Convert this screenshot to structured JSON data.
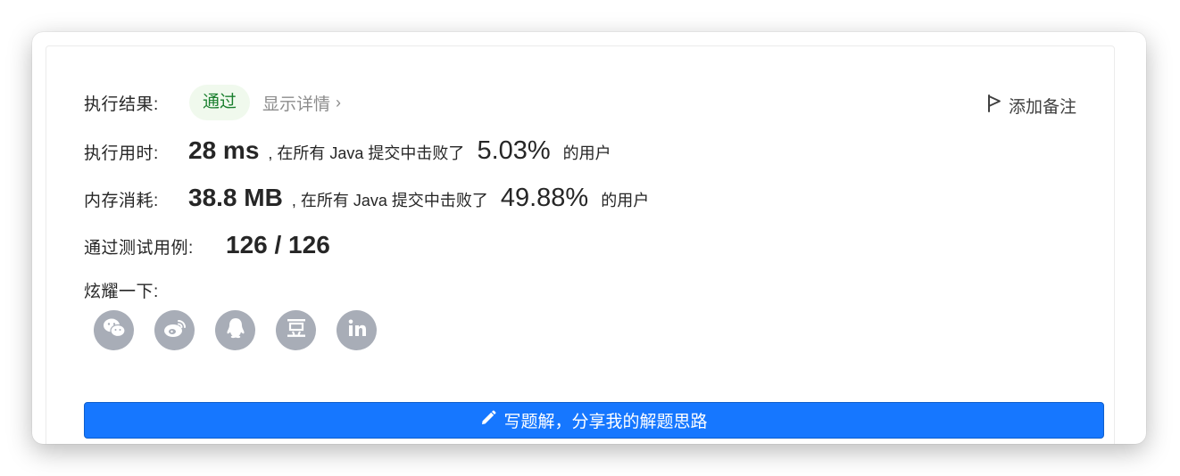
{
  "result": {
    "label": "执行结果:",
    "status": "通过",
    "details_link": "显示详情",
    "details_chevron": "›",
    "add_note": "添加备注"
  },
  "runtime": {
    "label": "执行用时:",
    "value": "28 ms",
    "text_before": ", 在所有 Java 提交中击败了",
    "percent": "5.03%",
    "text_after": "的用户"
  },
  "memory": {
    "label": "内存消耗:",
    "value": "38.8 MB",
    "text_before": ", 在所有 Java 提交中击败了",
    "percent": "49.88%",
    "text_after": "的用户"
  },
  "testcases": {
    "label": "通过测试用例:",
    "value": "126 / 126"
  },
  "share": {
    "label": "炫耀一下:",
    "icons": [
      "wechat-icon",
      "weibo-icon",
      "qq-icon",
      "douban-icon",
      "linkedin-icon"
    ]
  },
  "write_button": {
    "label": "写题解，分享我的解题思路"
  },
  "colors": {
    "accent": "#1677ff",
    "success_bg": "#f0f9ed",
    "success_text": "#1a7f2e",
    "share_icon_bg": "#a8adb7"
  }
}
